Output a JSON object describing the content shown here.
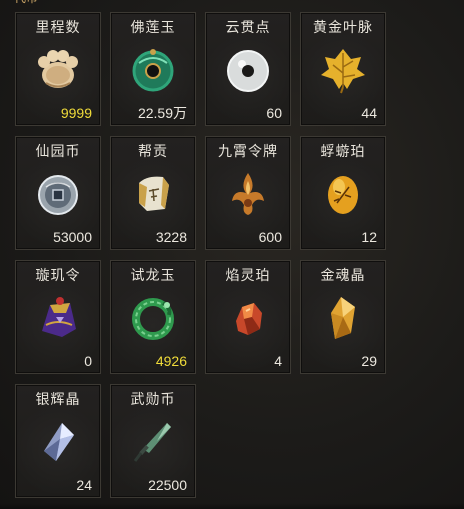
{
  "header": {
    "fragment": "代币"
  },
  "items": [
    {
      "name": "里程数",
      "count": "9999",
      "highlight": true,
      "icon": "paw-stone-icon"
    },
    {
      "name": "佛莲玉",
      "count": "22.59万",
      "highlight": false,
      "icon": "jade-disc-icon"
    },
    {
      "name": "云贯点",
      "count": "60",
      "highlight": false,
      "icon": "white-ring-icon"
    },
    {
      "name": "黄金叶脉",
      "count": "44",
      "highlight": false,
      "icon": "golden-leaf-icon"
    },
    {
      "name": "仙园币",
      "count": "53000",
      "highlight": false,
      "icon": "silver-coin-icon"
    },
    {
      "name": "帮贡",
      "count": "3228",
      "highlight": false,
      "icon": "scroll-token-icon"
    },
    {
      "name": "九霄令牌",
      "count": "600",
      "highlight": false,
      "icon": "flame-token-icon"
    },
    {
      "name": "蜉蝣珀",
      "count": "12",
      "highlight": false,
      "icon": "amber-insect-icon"
    },
    {
      "name": "璇玑令",
      "count": "0",
      "highlight": false,
      "icon": "purple-seal-icon"
    },
    {
      "name": "试龙玉",
      "count": "4926",
      "highlight": true,
      "icon": "green-dragon-jade-icon"
    },
    {
      "name": "焰灵珀",
      "count": "4",
      "highlight": false,
      "icon": "fire-amber-icon"
    },
    {
      "name": "金魂晶",
      "count": "29",
      "highlight": false,
      "icon": "gold-crystal-icon"
    },
    {
      "name": "银辉晶",
      "count": "24",
      "highlight": false,
      "icon": "silver-crystal-icon"
    },
    {
      "name": "武勋币",
      "count": "22500",
      "highlight": false,
      "icon": "jade-blade-icon"
    }
  ]
}
